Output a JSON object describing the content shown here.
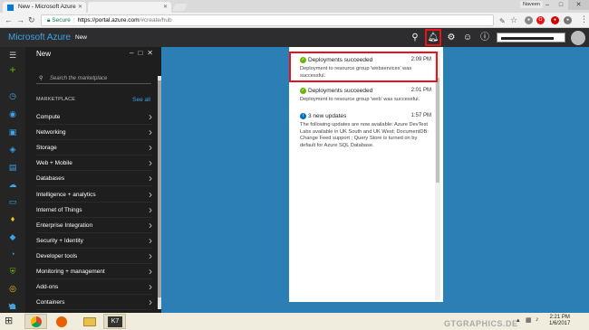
{
  "browser": {
    "tabs": [
      {
        "title": "New - Microsoft Azure"
      },
      {
        "title": ""
      }
    ],
    "user": "Naveen",
    "secure_label": "Secure",
    "url_host": "https://portal.azure.com",
    "url_path": "/#create/hub"
  },
  "header": {
    "brand": "Microsoft Azure",
    "breadcrumb": "New"
  },
  "blade": {
    "title": "New",
    "search_placeholder": "Search the marketplace",
    "section": "MARKETPLACE",
    "see_all": "See all",
    "categories": [
      "Compute",
      "Networking",
      "Storage",
      "Web + Mobile",
      "Databases",
      "Intelligence + analytics",
      "Internet of Things",
      "Enterprise Integration",
      "Security + Identity",
      "Developer tools",
      "Monitoring + management",
      "Add-ons",
      "Containers"
    ]
  },
  "notifications": [
    {
      "title": "Deployments succeeded",
      "time": "2:09 PM",
      "body": "Deployment to resource group 'webservices' was successful.",
      "status": "success"
    },
    {
      "title": "Deployments succeeded",
      "time": "2:01 PM",
      "body": "Deployment to resource group 'web' was successful.",
      "status": "success"
    },
    {
      "title": "3 new updates",
      "time": "1:57 PM",
      "body": "The following updates are now available: Azure DevTest Labs available in UK South and UK West; DocumentDB: Change Feed support ; Query Store is turned on by default for Azure SQL Database.",
      "status": "info"
    }
  ],
  "taskbar": {
    "watermark": "GTGRAPHICS.DE",
    "time": "2:21 PM",
    "date": "1/6/2017"
  },
  "colors": {
    "azure_blue": "#3ca3e6",
    "canvas": "#2c7fb4",
    "highlight": "#e8131b",
    "success": "#6bb700",
    "info": "#0072c6"
  }
}
